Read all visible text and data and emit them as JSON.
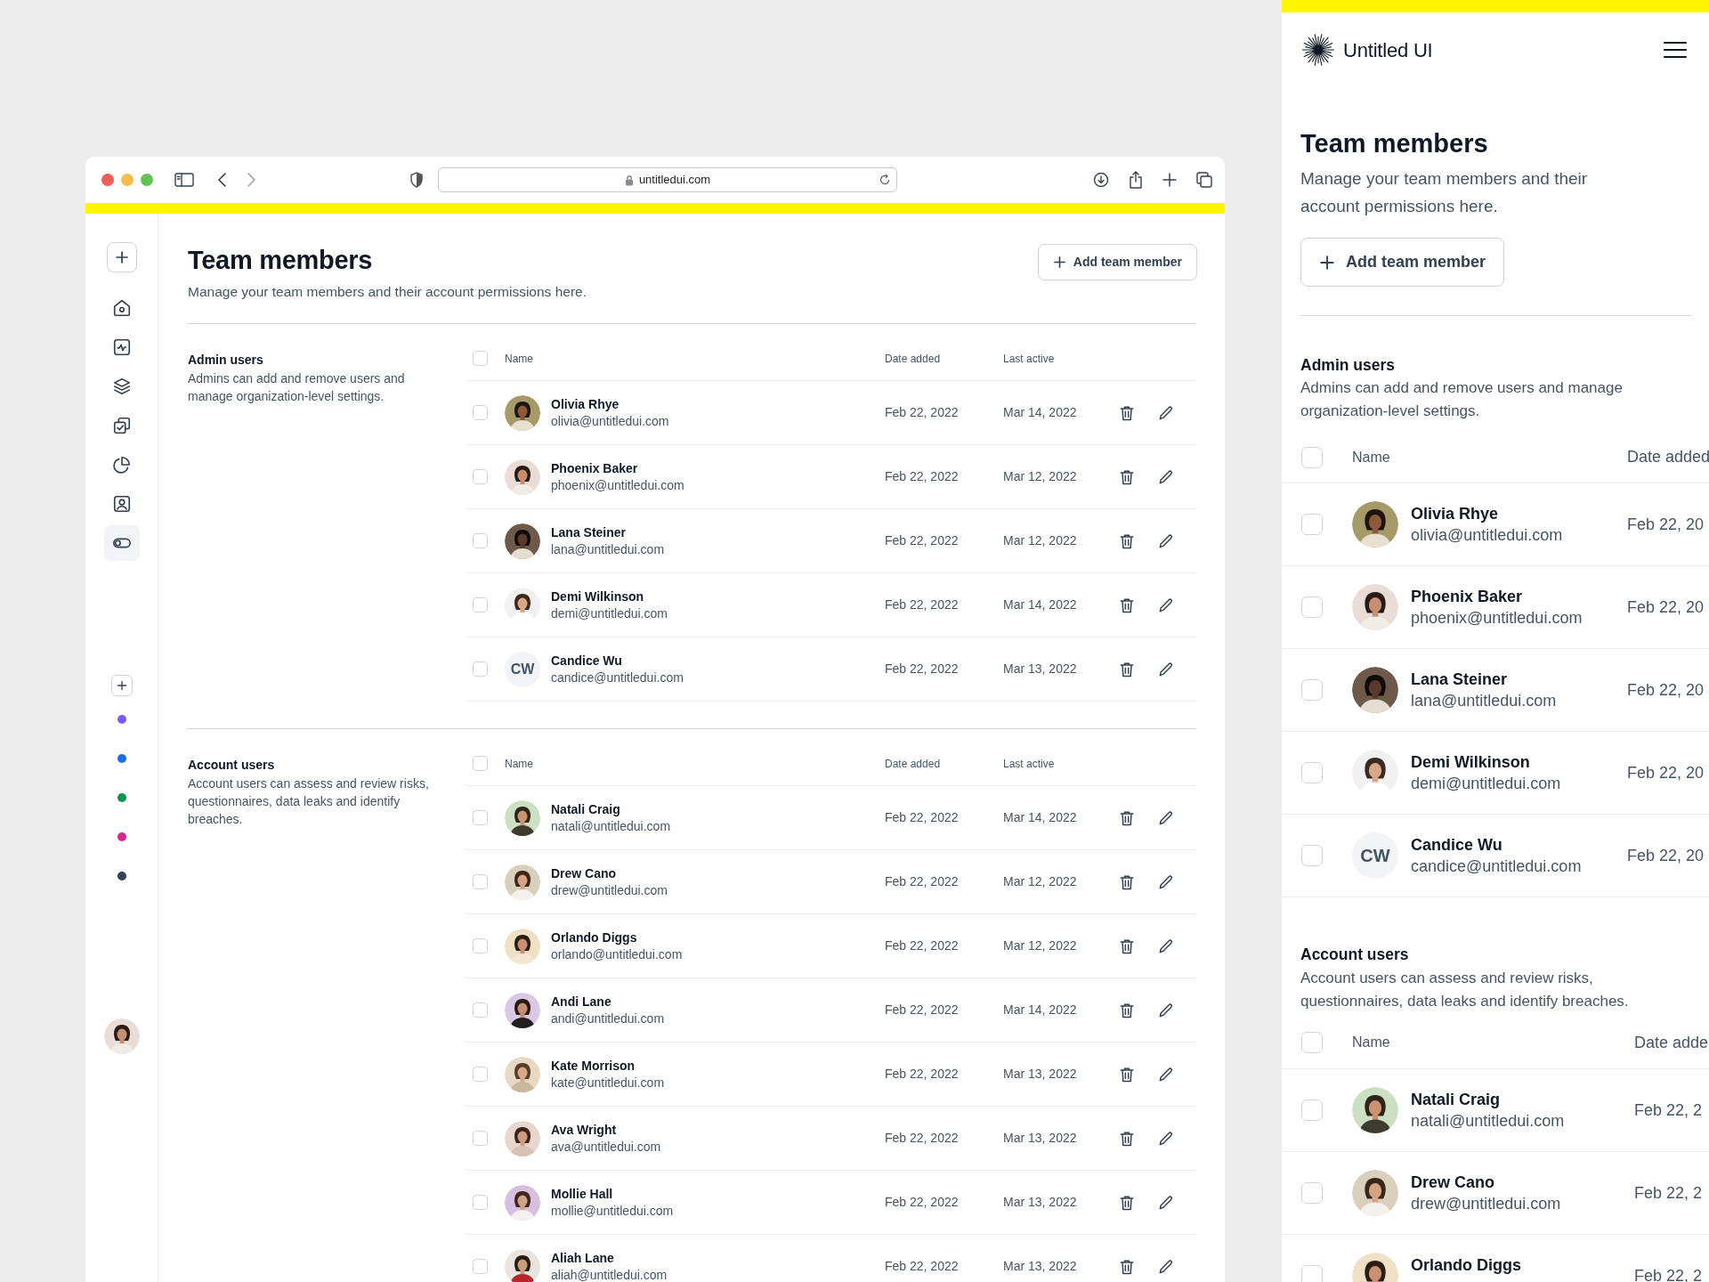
{
  "browser": {
    "url": "untitledui.com"
  },
  "sidebar": {
    "items": [
      {
        "kind": "home",
        "selected": false
      },
      {
        "kind": "activity",
        "selected": false
      },
      {
        "kind": "layers",
        "selected": false
      },
      {
        "kind": "tasks",
        "selected": false
      },
      {
        "kind": "chart",
        "selected": false
      },
      {
        "kind": "contact",
        "selected": false
      },
      {
        "kind": "toggle",
        "selected": true
      }
    ],
    "dots": [
      {
        "color": "#7a5af8"
      },
      {
        "color": "#1570ef"
      },
      {
        "color": "#079455"
      },
      {
        "color": "#dd2590"
      },
      {
        "color": "#344054"
      }
    ]
  },
  "page": {
    "title": "Team members",
    "subtitle": "Manage your team members and their account permissions here.",
    "add_button": "Add team member"
  },
  "sections": [
    {
      "title": "Admin users",
      "description": "Admins can add and remove users and manage organization-level settings.",
      "header_checked": false,
      "columns": [
        "Name",
        "Date added",
        "Last active"
      ],
      "rows": [
        {
          "name": "Olivia Rhye",
          "email": "olivia@untitledui.com",
          "date_added": "Feb 22, 2022",
          "last_active": "Mar 14, 2022",
          "checked": false
        },
        {
          "name": "Phoenix Baker",
          "email": "phoenix@untitledui.com",
          "date_added": "Feb 22, 2022",
          "last_active": "Mar 12, 2022",
          "checked": false
        },
        {
          "name": "Lana Steiner",
          "email": "lana@untitledui.com",
          "date_added": "Feb 22, 2022",
          "last_active": "Mar 12, 2022",
          "checked": false
        },
        {
          "name": "Demi Wilkinson",
          "email": "demi@untitledui.com",
          "date_added": "Feb 22, 2022",
          "last_active": "Mar 14, 2022",
          "checked": false
        },
        {
          "name": "Candice Wu",
          "email": "candice@untitledui.com",
          "date_added": "Feb 22, 2022",
          "last_active": "Mar 13, 2022",
          "checked": false,
          "avatar": {
            "kind": "initials",
            "initials": "CW"
          }
        }
      ]
    },
    {
      "title": "Account users",
      "description": "Account users can assess and review risks, questionnaires, data leaks and identify breaches.",
      "header_checked": false,
      "columns": [
        "Name",
        "Date added",
        "Last active"
      ],
      "rows": [
        {
          "name": "Natali Craig",
          "email": "natali@untitledui.com",
          "date_added": "Feb 22, 2022",
          "last_active": "Mar 14, 2022",
          "checked": false
        },
        {
          "name": "Drew Cano",
          "email": "drew@untitledui.com",
          "date_added": "Feb 22, 2022",
          "last_active": "Mar 12, 2022",
          "checked": false
        },
        {
          "name": "Orlando Diggs",
          "email": "orlando@untitledui.com",
          "date_added": "Feb 22, 2022",
          "last_active": "Mar 12, 2022",
          "checked": false
        },
        {
          "name": "Andi Lane",
          "email": "andi@untitledui.com",
          "date_added": "Feb 22, 2022",
          "last_active": "Mar 14, 2022",
          "checked": false
        },
        {
          "name": "Kate Morrison",
          "email": "kate@untitledui.com",
          "date_added": "Feb 22, 2022",
          "last_active": "Mar 13, 2022",
          "checked": false
        },
        {
          "name": "Ava Wright",
          "email": "ava@untitledui.com",
          "date_added": "Feb 22, 2022",
          "last_active": "Mar 13, 2022",
          "checked": false
        },
        {
          "name": "Mollie Hall",
          "email": "mollie@untitledui.com",
          "date_added": "Feb 22, 2022",
          "last_active": "Mar 13, 2022",
          "checked": false
        },
        {
          "name": "Aliah Lane",
          "email": "aliah@untitledui.com",
          "date_added": "Feb 22, 2022",
          "last_active": "Mar 13, 2022",
          "checked": false
        }
      ]
    }
  ],
  "mobile": {
    "brand": "Untitled UI",
    "title": "Team members",
    "subtitle": "Manage your team members and their account permissions here.",
    "add_button": "Add team member",
    "sections": [
      {
        "title": "Admin users",
        "description": "Admins can add and remove users and manage organization-level settings.",
        "header_checked": false,
        "columns": [
          "Name",
          "Date added"
        ],
        "rows": [
          {
            "name": "Olivia Rhye",
            "email": "olivia@untitledui.com",
            "date_added": "Feb 22, 20",
            "checked": false
          },
          {
            "name": "Phoenix Baker",
            "email": "phoenix@untitledui.com",
            "date_added": "Feb 22, 20",
            "checked": false
          },
          {
            "name": "Lana Steiner",
            "email": "lana@untitledui.com",
            "date_added": "Feb 22, 20",
            "checked": false
          },
          {
            "name": "Demi Wilkinson",
            "email": "demi@untitledui.com",
            "date_added": "Feb 22, 20",
            "checked": false
          },
          {
            "name": "Candice Wu",
            "email": "candice@untitledui.com",
            "date_added": "Feb 22, 20",
            "checked": false,
            "avatar": {
              "kind": "initials",
              "initials": "CW"
            }
          }
        ]
      },
      {
        "title": "Account users",
        "description": "Account users can assess and review risks, questionnaires, data leaks and identify breaches.",
        "header_checked": false,
        "columns": [
          "Name",
          "Date adde"
        ],
        "rows": [
          {
            "name": "Natali Craig",
            "email": "natali@untitledui.com",
            "date_added": "Feb 22, 2",
            "checked": false
          },
          {
            "name": "Drew Cano",
            "email": "drew@untitledui.com",
            "date_added": "Feb 22, 2",
            "checked": false
          },
          {
            "name": "Orlando Diggs",
            "date_added": "Feb 22, 2",
            "checked": false
          }
        ]
      }
    ]
  }
}
